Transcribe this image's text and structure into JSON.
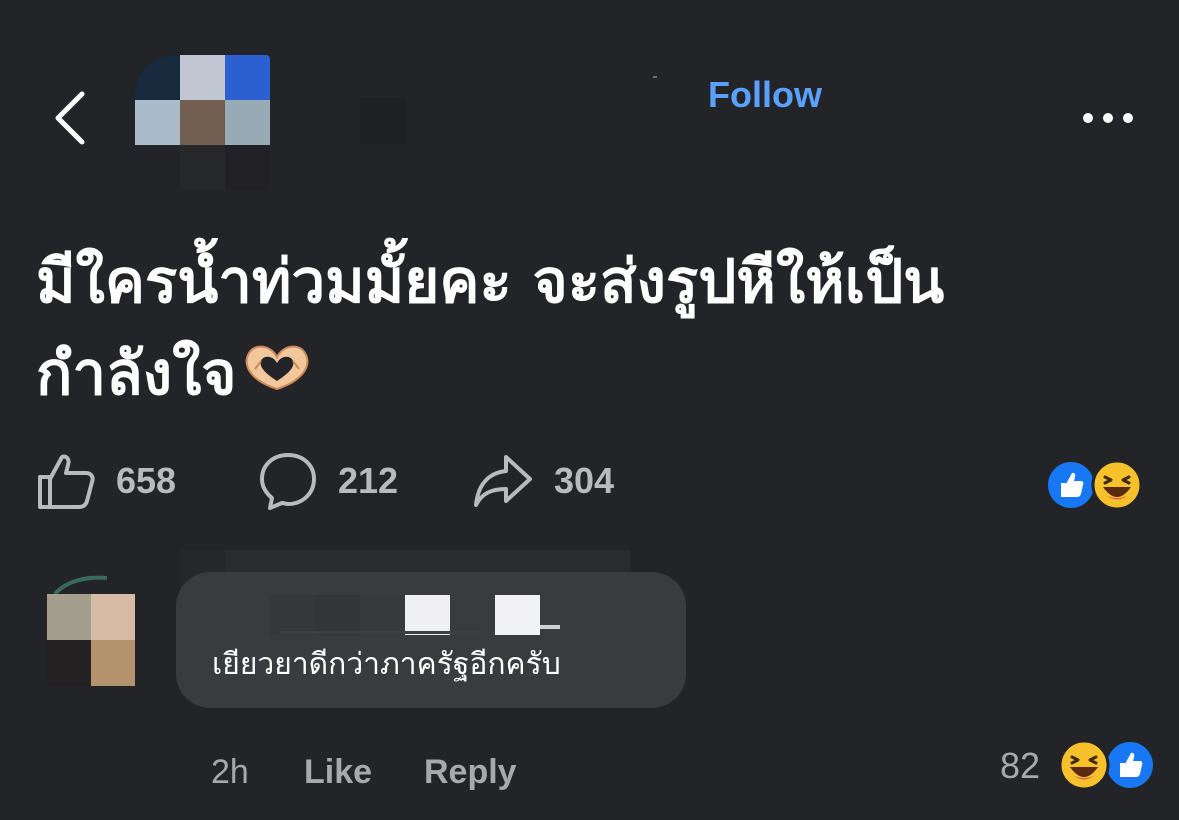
{
  "header": {
    "follow_label": "Follow"
  },
  "post": {
    "text_line1": "มีใครน้ำท่วมมั้ยคะ จะส่งรูปหีให้เป็น",
    "text_line2": "กำลังใจ",
    "emoji": "heart-hands",
    "likes": "658",
    "comments": "212",
    "shares": "304",
    "reactions": [
      "like",
      "haha"
    ]
  },
  "comment": {
    "text": "เยียวยาดีกว่าภาครัฐอีกครับ",
    "time": "2h",
    "like_label": "Like",
    "reply_label": "Reply",
    "reaction_count": "82",
    "reactions": [
      "haha",
      "like"
    ]
  },
  "colors": {
    "background": "#232427",
    "follow": "#5aa1ff",
    "bubble": "#3a3b3e",
    "meta_text": "#a8a9ad",
    "like_blue": "#1877f2",
    "haha_yellow": "#f7c12c"
  }
}
